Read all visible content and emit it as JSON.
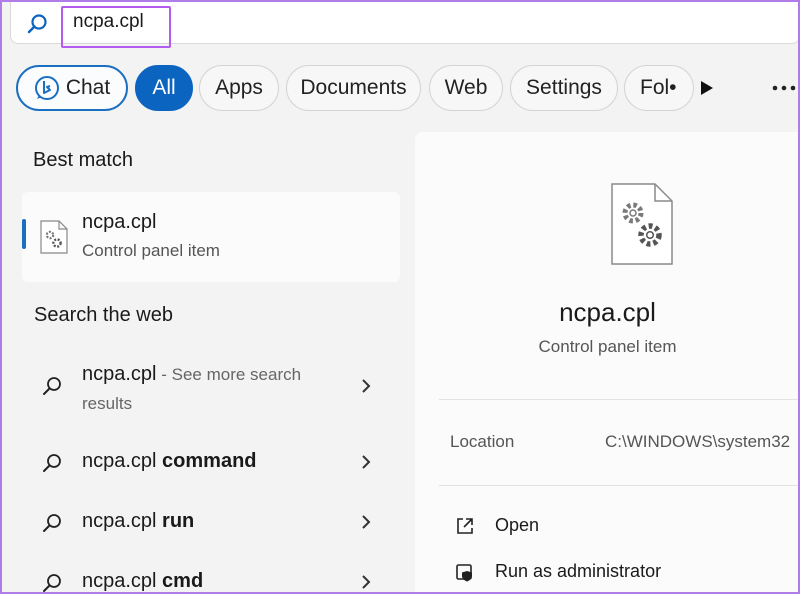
{
  "search": {
    "query": "ncpa.cpl"
  },
  "filters": {
    "chat": "Chat",
    "all": "All",
    "apps": "Apps",
    "documents": "Documents",
    "web": "Web",
    "settings": "Settings",
    "folders": "Fol•"
  },
  "best_match": {
    "heading": "Best match",
    "title": "ncpa.cpl",
    "subtitle": "Control panel item"
  },
  "web_search": {
    "heading": "Search the web",
    "items": [
      {
        "query": "ncpa.cpl",
        "hint": " - See more search",
        "hint_line2": "results"
      },
      {
        "query": "ncpa.cpl",
        "bold": " command"
      },
      {
        "query": "ncpa.cpl",
        "bold": " run"
      },
      {
        "query": "ncpa.cpl",
        "bold": " cmd"
      }
    ]
  },
  "detail": {
    "title": "ncpa.cpl",
    "subtitle": "Control panel item",
    "location_label": "Location",
    "location_value": "C:\\WINDOWS\\system32",
    "actions": [
      {
        "label": "Open",
        "icon": "open-external-icon"
      },
      {
        "label": "Run as administrator",
        "icon": "shield-icon"
      }
    ]
  },
  "colors": {
    "accent": "#0a64c0",
    "highlight": "#b45cf0"
  }
}
